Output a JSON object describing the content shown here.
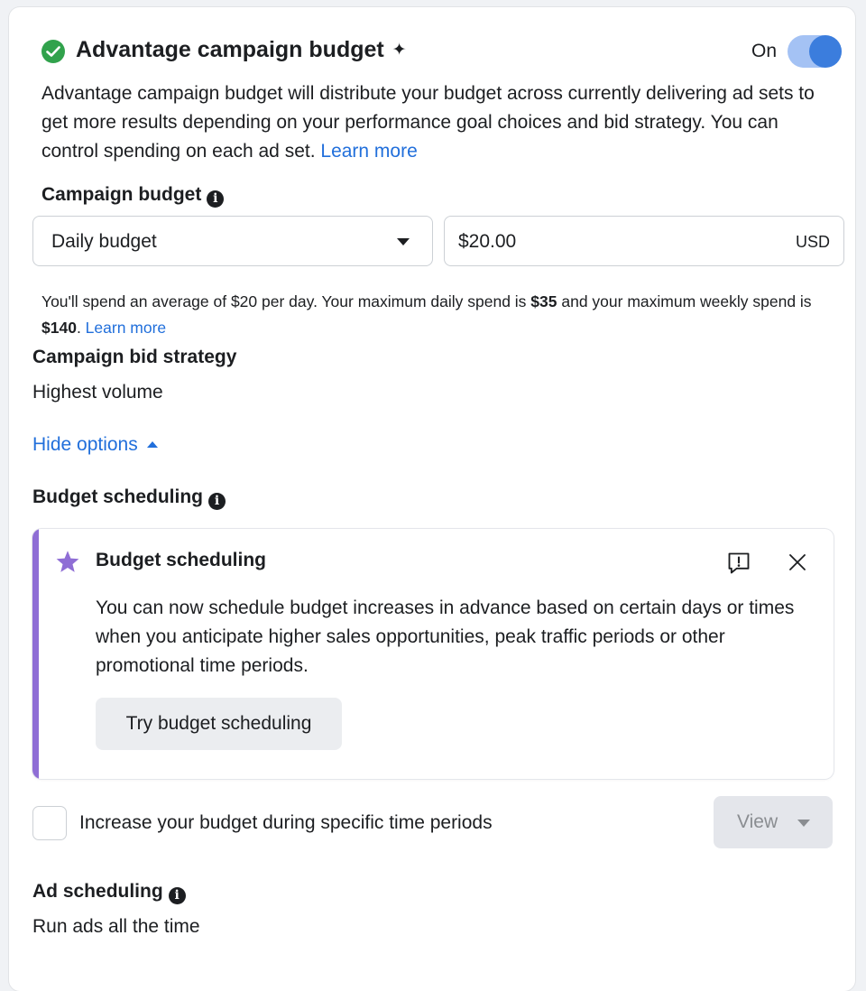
{
  "header": {
    "title": "Advantage campaign budget",
    "sparkle": "✦",
    "toggle_label": "On",
    "toggle_state": "on"
  },
  "description": {
    "text": "Advantage campaign budget will distribute your budget across currently delivering ad sets to get more results depending on your performance goal choices and bid strategy. You can control spending on each ad set. ",
    "link": "Learn more"
  },
  "campaign_budget": {
    "label": "Campaign budget",
    "budget_type": "Daily budget",
    "amount": "$20.00",
    "currency": "USD"
  },
  "spend_info": {
    "part1": "You'll spend an average of $20 per day. Your maximum daily spend is ",
    "max_daily": "$35",
    "part2": " and your maximum weekly spend is ",
    "max_weekly": "$140",
    "part3": ". ",
    "link": "Learn more"
  },
  "bid_strategy": {
    "label": "Campaign bid strategy",
    "value": "Highest volume"
  },
  "hide_options": "Hide options",
  "budget_scheduling": {
    "label": "Budget scheduling",
    "promo_title": "Budget scheduling",
    "promo_body": "You can now schedule budget increases in advance based on certain days or times when you anticipate higher sales opportunities, peak traffic periods or other promotional time periods.",
    "promo_button": "Try budget scheduling",
    "checkbox_label": "Increase your budget during specific time periods",
    "view_button": "View"
  },
  "ad_scheduling": {
    "label": "Ad scheduling",
    "value": "Run ads all the time"
  },
  "colors": {
    "accent": "#216fdb",
    "success": "#31a24c",
    "promo_bar": "#8f6ed5"
  },
  "icons": [
    "check-circle-icon",
    "sparkle-icon",
    "info-icon",
    "chevron-down-icon",
    "caret-up-icon",
    "star-icon",
    "feedback-icon",
    "close-icon"
  ]
}
